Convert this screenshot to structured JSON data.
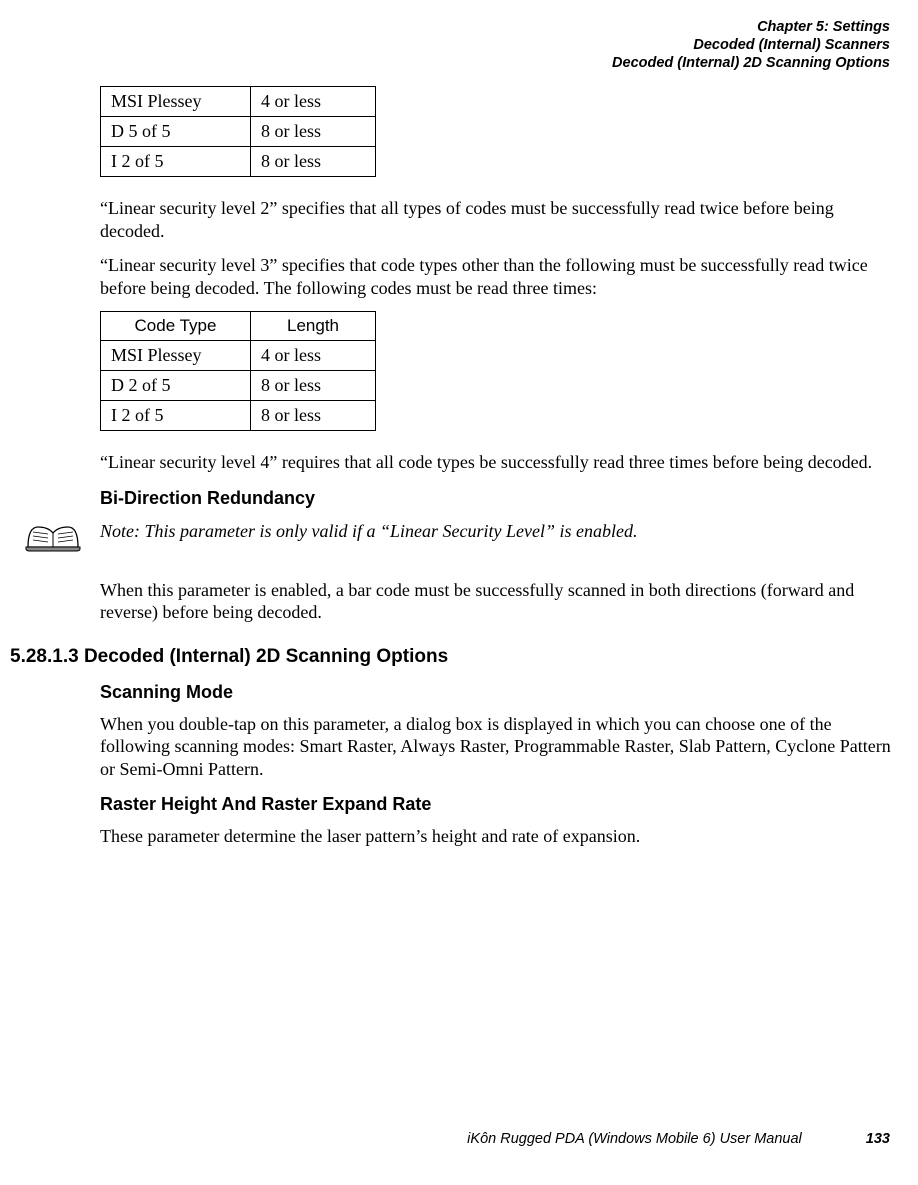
{
  "header": {
    "line1": "Chapter 5: Settings",
    "line2": "Decoded (Internal) Scanners",
    "line3": "Decoded (Internal) 2D Scanning Options"
  },
  "table1": {
    "rows": [
      {
        "c1": "MSI Plessey",
        "c2": "4 or less"
      },
      {
        "c1": "D 5 of 5",
        "c2": "8 or less"
      },
      {
        "c1": "I 2 of 5",
        "c2": "8 or less"
      }
    ]
  },
  "para1": "“Linear security level 2” specifies that all types of codes must be successfully read twice before being decoded.",
  "para2": "“Linear security level 3” specifies that code types other than the following must be successfully read twice before being decoded. The following codes must be read three times:",
  "table2": {
    "head": {
      "c1": "Code Type",
      "c2": "Length"
    },
    "rows": [
      {
        "c1": "MSI Plessey",
        "c2": "4 or less"
      },
      {
        "c1": "D 2 of 5",
        "c2": "8 or less"
      },
      {
        "c1": "I 2 of 5",
        "c2": "8 or less"
      }
    ]
  },
  "para3": "“Linear security level 4” requires that all code types be successfully read three times before being decoded.",
  "sub1": "Bi-Direction Redundancy",
  "note1": "Note: This parameter is only valid if a “Linear Security Level” is enabled.",
  "para4": "When this parameter is enabled, a bar code must be successfully scanned in both directions (forward and reverse) before being decoded.",
  "section_head": "5.28.1.3 Decoded (Internal) 2D Scanning Options",
  "sub2": "Scanning Mode",
  "para5": "When you double-tap on this parameter, a dialog box is displayed in which you can choose one of the following scanning modes: Smart Raster, Always Raster, Programmable Raster, Slab Pattern, Cyclone Pattern or Semi-Omni Pattern.",
  "sub3": "Raster Height And Raster Expand Rate",
  "para6": "These parameter determine the laser pattern’s height and rate of expansion.",
  "footer": {
    "text": "iKôn Rugged PDA (Windows Mobile 6) User Manual",
    "page": "133"
  }
}
